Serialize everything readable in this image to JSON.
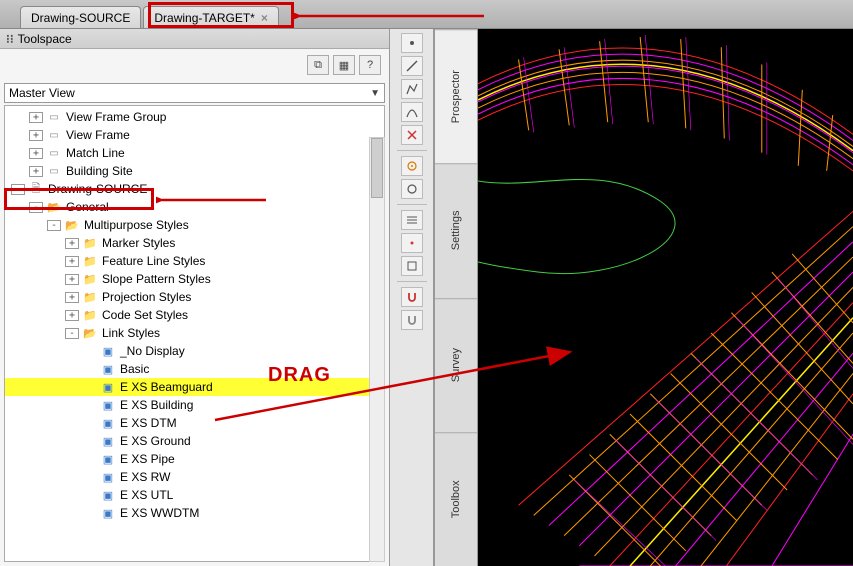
{
  "tabs": [
    {
      "label": "Drawing-SOURCE",
      "closable": false
    },
    {
      "label": "Drawing-TARGET*",
      "closable": true
    }
  ],
  "panel_title": "Toolspace",
  "view_selector": "Master View",
  "toolbuttons": {
    "a": "⧉",
    "b": "▦",
    "c": "?"
  },
  "side_tabs": [
    "Prospector",
    "Settings",
    "Survey",
    "Toolbox"
  ],
  "tree": [
    {
      "d": 1,
      "exp": "+",
      "icon": "i-grp",
      "label": "View Frame Group"
    },
    {
      "d": 1,
      "exp": "+",
      "icon": "i-grp",
      "label": "View Frame"
    },
    {
      "d": 1,
      "exp": "+",
      "icon": "i-grp",
      "label": "Match Line"
    },
    {
      "d": 1,
      "exp": "+",
      "icon": "i-grp",
      "label": "Building Site"
    },
    {
      "d": 0,
      "exp": "-",
      "icon": "i-file",
      "label": "Drawing-SOURCE"
    },
    {
      "d": 1,
      "exp": "-",
      "icon": "i-folderopen",
      "label": "General"
    },
    {
      "d": 2,
      "exp": "-",
      "icon": "i-folderopen",
      "label": "Multipurpose Styles"
    },
    {
      "d": 3,
      "exp": "+",
      "icon": "i-folder",
      "label": "Marker Styles"
    },
    {
      "d": 3,
      "exp": "+",
      "icon": "i-folder",
      "label": "Feature Line Styles"
    },
    {
      "d": 3,
      "exp": "+",
      "icon": "i-folder",
      "label": "Slope Pattern Styles"
    },
    {
      "d": 3,
      "exp": "+",
      "icon": "i-folder",
      "label": "Projection Styles"
    },
    {
      "d": 3,
      "exp": "+",
      "icon": "i-folder",
      "label": "Code Set Styles"
    },
    {
      "d": 3,
      "exp": "-",
      "icon": "i-folderopen",
      "label": "Link Styles"
    },
    {
      "d": 4,
      "exp": "",
      "icon": "i-style",
      "label": "_No Display"
    },
    {
      "d": 4,
      "exp": "",
      "icon": "i-style",
      "label": "Basic"
    },
    {
      "d": 4,
      "exp": "",
      "icon": "i-style",
      "label": "E XS Beamguard",
      "hl": true
    },
    {
      "d": 4,
      "exp": "",
      "icon": "i-style",
      "label": "E XS Building"
    },
    {
      "d": 4,
      "exp": "",
      "icon": "i-style",
      "label": "E XS DTM"
    },
    {
      "d": 4,
      "exp": "",
      "icon": "i-style",
      "label": "E XS Ground"
    },
    {
      "d": 4,
      "exp": "",
      "icon": "i-style",
      "label": "E XS Pipe"
    },
    {
      "d": 4,
      "exp": "",
      "icon": "i-style",
      "label": "E XS RW"
    },
    {
      "d": 4,
      "exp": "",
      "icon": "i-style",
      "label": "E XS UTL"
    },
    {
      "d": 4,
      "exp": "",
      "icon": "i-style",
      "label": "E XS WWDTM"
    }
  ],
  "annotations": {
    "drag": "DRAG"
  }
}
